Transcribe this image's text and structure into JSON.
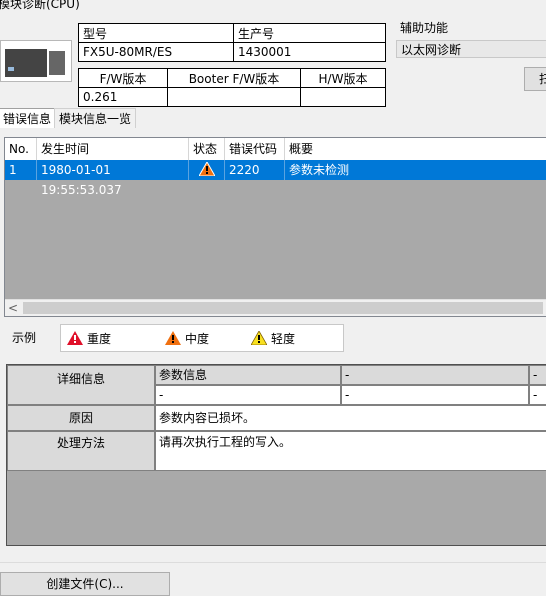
{
  "window": {
    "title": "模块诊断(CPU)"
  },
  "module": {
    "labels": {
      "model": "型号",
      "serial": "生产号",
      "fw": "F/W版本",
      "booter": "Booter F/W版本",
      "hw": "H/W版本"
    },
    "model": "FX5U-80MR/ES",
    "serial": "1430001",
    "fw_version": "0.261",
    "booter_version": "",
    "hw_version": ""
  },
  "aux": {
    "title": "辅助功能",
    "selected": "以太网诊断",
    "button_label": "扫"
  },
  "tabs": [
    {
      "label": "错误信息"
    },
    {
      "label": "模块信息一览"
    }
  ],
  "error_table": {
    "headers": {
      "no": "No.",
      "time": "发生时间",
      "status": "状态",
      "code": "错误代码",
      "summary": "概要"
    },
    "rows": [
      {
        "no": "1",
        "time": "1980-01-01 19:55:53.037",
        "status_icon": "warning-orange-icon",
        "code": "2220",
        "summary": "参数未检测"
      }
    ]
  },
  "legend": {
    "label": "示例",
    "major": "重度",
    "moderate": "中度",
    "minor": "轻度"
  },
  "detail": {
    "labels": {
      "detail_info": "详细信息",
      "cause": "原因",
      "action": "处理方法"
    },
    "info_row1": [
      "参数信息",
      "-",
      "-"
    ],
    "info_row2": [
      "-",
      "-",
      "-"
    ],
    "cause": "参数内容已损坏。",
    "action": "请再次执行工程的写入。"
  },
  "buttons": {
    "create_file": "创建文件(C)..."
  },
  "colors": {
    "selection": "#0078d7",
    "major": "#e0102a",
    "moderate": "#f07010",
    "minor": "#f8e020"
  }
}
